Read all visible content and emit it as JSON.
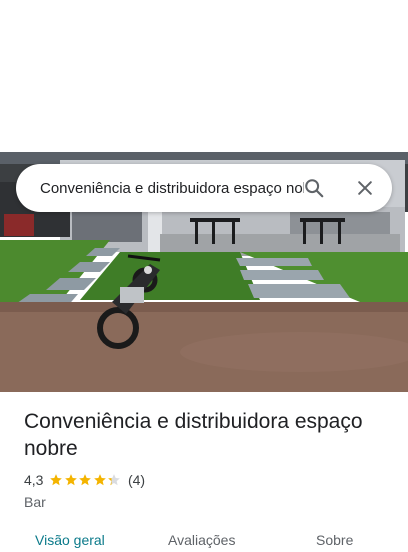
{
  "search": {
    "value": "Conveniência e distribuidora espaço nobre",
    "search_icon": "search-icon",
    "close_icon": "close-icon"
  },
  "place": {
    "name": "Conveniência e distribuidora espaço nobre",
    "rating": "4,3",
    "rating_value": 4.3,
    "review_count": "(4)",
    "category": "Bar",
    "star_color": "#f4b400"
  },
  "tabs": [
    {
      "label": "Visão geral",
      "active": true
    },
    {
      "label": "Avaliações",
      "active": false
    },
    {
      "label": "Sobre",
      "active": false
    }
  ],
  "colors": {
    "accent": "#0b7a8a"
  }
}
